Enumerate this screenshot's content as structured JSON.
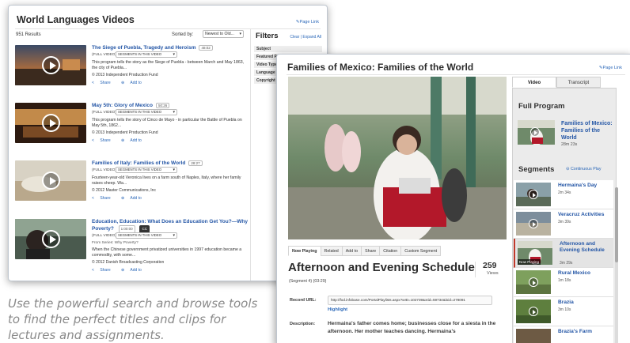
{
  "search_window": {
    "title": "World Languages Videos",
    "page_link": "✎Page Link",
    "results_count": "951 Results",
    "sorted_by_label": "Sorted by:",
    "sort_value": "Newest to Old...",
    "results": [
      {
        "title": "The Siege of Puebla, Tragedy and Heroism",
        "duration": "48:02",
        "full_video": "(FULL VIDEO)",
        "segments": "SEGMENTS IN THIS VIDEO",
        "description": "This program tells the story as the Siege of Puebla - between March and May 1863, the city of Puebla...",
        "copyright": "© 2013 Independent Production Fund",
        "share": "Share",
        "add_to": "Add to"
      },
      {
        "title": "May 5th: Glory of Mexico",
        "duration": "50:26",
        "full_video": "(FULL VIDEO)",
        "segments": "SEGMENTS IN THIS VIDEO",
        "description": "This program tells the story of Cinco de Mayo - in particular the Battle of Puebla on May 5th, 1862...",
        "copyright": "© 2013 Independent Production Fund",
        "share": "Share",
        "add_to": "Add to"
      },
      {
        "title": "Families of Italy: Families of the World",
        "duration": "28:27",
        "full_video": "(FULL VIDEO)",
        "segments": "SEGMENTS IN THIS VIDEO",
        "description": "Fourteen-year-old Veronica lives on a farm south of Naples, Italy, where her family raises sheep. Wa...",
        "copyright": "© 2012 Master Communications, Inc",
        "share": "Share",
        "add_to": "Add to"
      },
      {
        "title": "Education, Education: What Does an Education Get You?—Why Poverty?",
        "duration": "1:00:00",
        "cc": "CC",
        "full_video": "(FULL VIDEO)",
        "segments": "SEGMENTS IN THIS VIDEO",
        "series": "From Series: Why Poverty?",
        "description": "When the Chinese government privatized universities in 1997 education became a commodity, with some...",
        "copyright": "© 2012 Danish Broadcasting Corporation",
        "share": "Share",
        "add_to": "Add to"
      }
    ],
    "filters": {
      "title": "Filters",
      "links": "Clear | Expand All",
      "items": [
        "Subject",
        "Featured Pro",
        "Video Type",
        "Language",
        "Copyright Da"
      ]
    }
  },
  "video_window": {
    "title": "Families of Mexico: Families of the World",
    "page_link": "✎Page Link",
    "tabs": [
      "Now Playing",
      "Related",
      "Add to",
      "Share",
      "Citation",
      "Custom Segment"
    ],
    "clip_title": "Afternoon and Evening Schedule",
    "views_count": "259",
    "views_label": "Views",
    "segment_meta": "(Segment 4) (03:29)",
    "record_url_label": "Record URL:",
    "record_url": "http://fod.infobase.com/PortalPlaylists.aspx?wID=102739&xtid=59734&loid=278091",
    "highlight": "Highlight",
    "description_label": "Description:",
    "description": "Hermaina's father comes home; businesses close for a siesta in the afternoon. Her mother teaches dancing. Hermaina's",
    "side": {
      "tab_video": "Video",
      "tab_transcript": "Transcript",
      "full_program_title": "Full Program",
      "full_program_name": "Families of Mexico: Families of the World",
      "full_program_duration": "28m 23s",
      "segments_title": "Segments",
      "continuous_play": "Continuous Play",
      "now_playing_badge": "Now Playing",
      "segments": [
        {
          "name": "Hermaina's Day",
          "duration": "2m 34s"
        },
        {
          "name": "Veracruz Activities",
          "duration": "3m 39s"
        },
        {
          "name": "Afternoon and Evening Schedule",
          "duration": "3m 29s"
        },
        {
          "name": "Rural Mexico",
          "duration": "1m 18s"
        },
        {
          "name": "Brazia",
          "duration": "3m 10s"
        },
        {
          "name": "Brazia's Farm",
          "duration": ""
        }
      ]
    }
  },
  "caption": "Use the powerful search and browse tools to find the perfect titles and clips for lectures and assignments."
}
